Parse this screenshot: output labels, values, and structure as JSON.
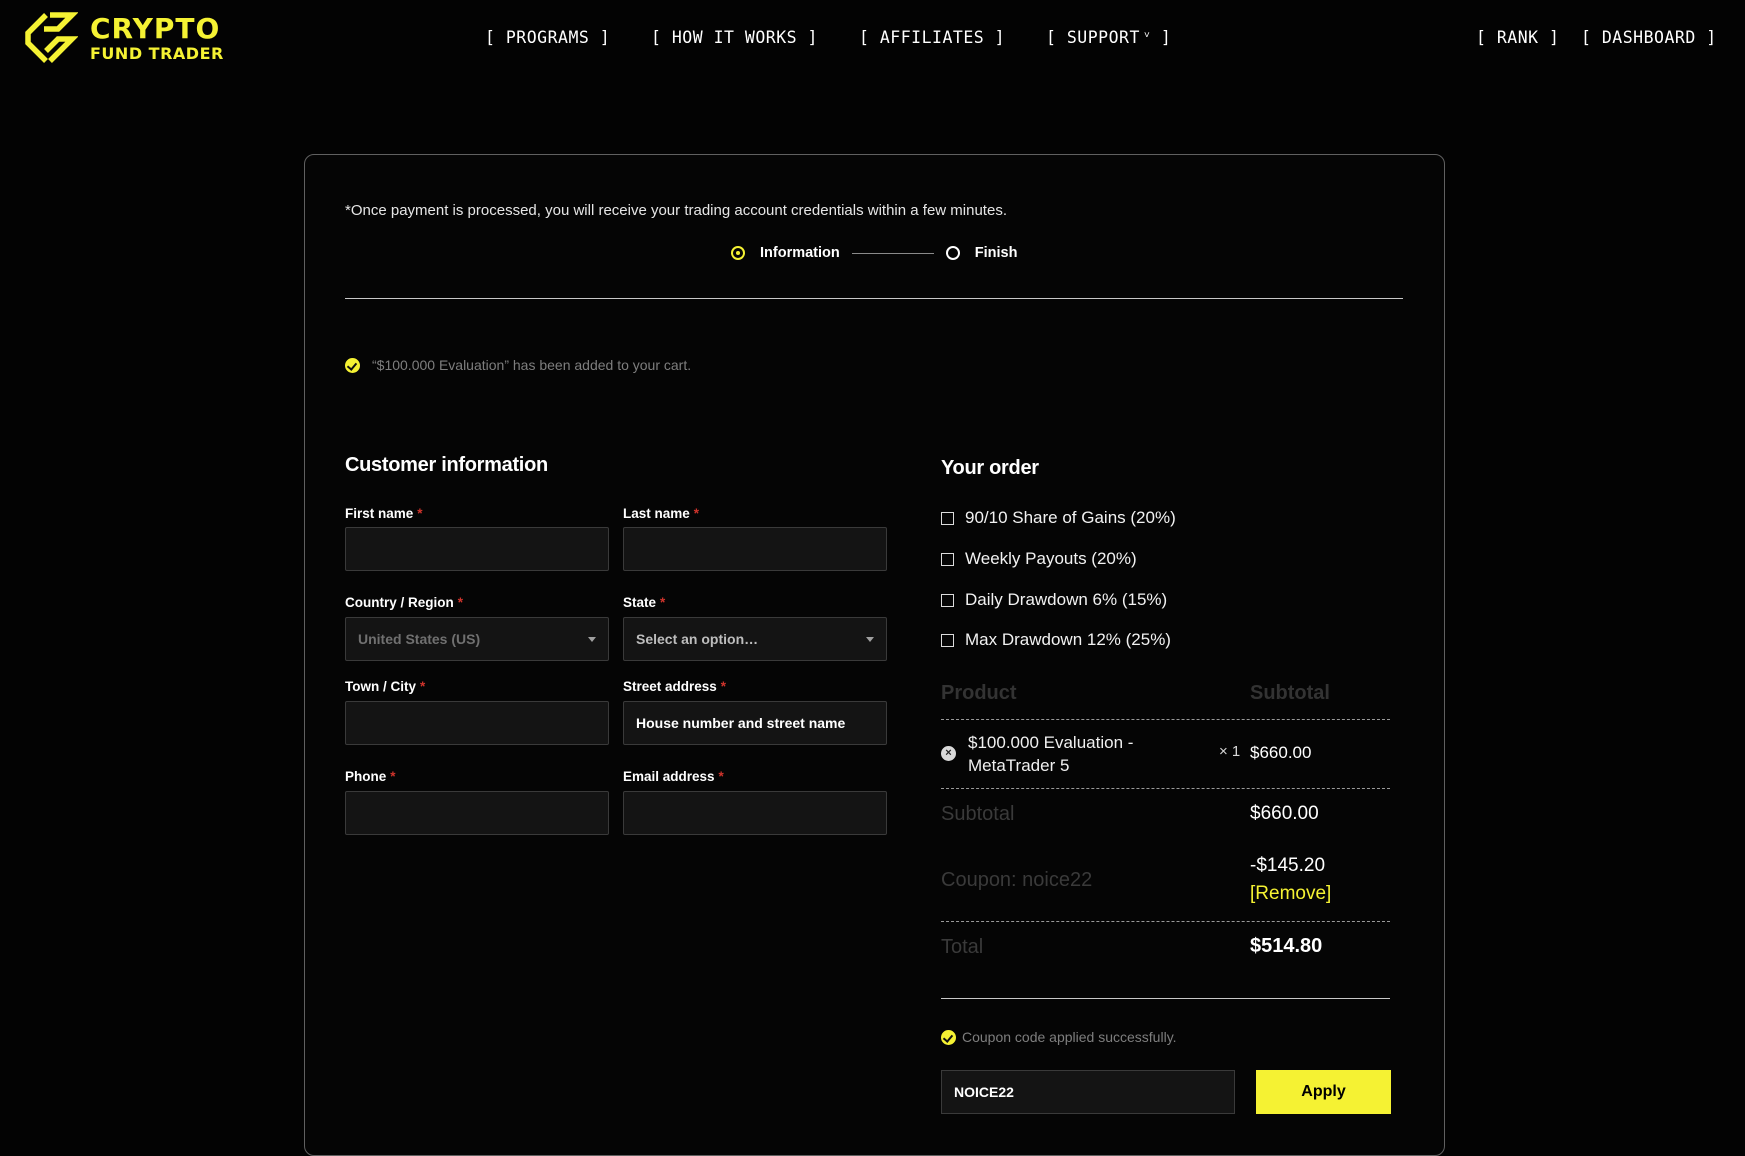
{
  "brand": {
    "line1": "CRYPTO",
    "line2": "FUND TRADER",
    "color": "#f5f233"
  },
  "nav": {
    "programs": "[ PROGRAMS ]",
    "how_it_works": "[ HOW IT WORKS ]",
    "affiliates": "[ AFFILIATES ]",
    "support": "[ SUPPORT",
    "support_caret": "˅",
    "support_close": "]",
    "rank": "[ RANK ]",
    "dashboard": "[ DASHBOARD ]"
  },
  "checkout": {
    "notice": "*Once payment is processed, you will receive your trading account credentials within a few minutes.",
    "steps": {
      "information": "Information",
      "finish": "Finish"
    },
    "cart_message": "“$100.000 Evaluation” has been added to your cart."
  },
  "customer": {
    "title": "Customer information",
    "required_mark": "*",
    "first_name": "First name",
    "last_name": "Last name",
    "country": "Country / Region",
    "country_value": "United States (US)",
    "state": "State",
    "state_value": "Select an option…",
    "town": "Town / City",
    "street": "Street address",
    "street_placeholder": "House number and street name",
    "phone": "Phone",
    "email": "Email address"
  },
  "order": {
    "title": "Your order",
    "addons": [
      "90/10 Share of Gains (20%)",
      "Weekly Payouts (20%)",
      "Daily Drawdown 6% (15%)",
      "Max Drawdown 12% (25%)"
    ],
    "col_product": "Product",
    "col_subtotal": "Subtotal",
    "product_line1": "$100.000 Evaluation -",
    "product_line2": "MetaTrader 5",
    "qty": "× 1",
    "product_price": "$660.00",
    "subtotal_label": "Subtotal",
    "subtotal_value": "$660.00",
    "coupon_label": "Coupon: noice22",
    "coupon_value": "-$145.20",
    "coupon_remove": "[Remove]",
    "total_label": "Total",
    "total_value": "$514.80",
    "coupon_success": "Coupon code applied successfully.",
    "coupon_code": "NOICE22",
    "apply": "Apply"
  }
}
